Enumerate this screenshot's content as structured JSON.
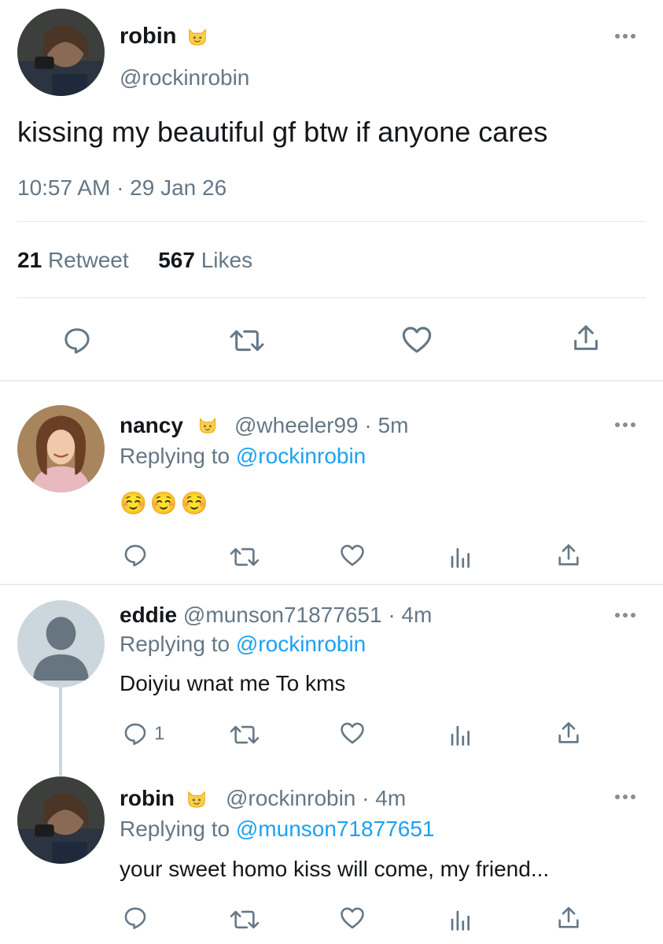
{
  "main_tweet": {
    "name": "robin",
    "handle": "@rockinrobin",
    "text": "kissing my beautiful gf btw if anyone cares",
    "meta": "10:57 AM · 29 Jan 26",
    "retweet_count": "21",
    "retweet_label": "Retweet",
    "like_count": "567",
    "like_label": "Likes"
  },
  "replies": [
    {
      "name": "nancy",
      "handle": "@wheeler99",
      "time": "· 5m",
      "replying_prefix": "Replying to",
      "replying_to": "@rockinrobin",
      "text": "☺️☺️☺️"
    },
    {
      "name": "eddie",
      "handle": "@munson71877651",
      "time": "· 4m",
      "replying_prefix": "Replying to",
      "replying_to": "@rockinrobin",
      "text": "Doiyiu wnat me To kms",
      "reply_count": "1"
    },
    {
      "name": "robin",
      "handle": "@rockinrobin",
      "time": "· 4m",
      "replying_prefix": "Replying to",
      "replying_to": "@munson71877651",
      "text": "your sweet homo kiss will come, my friend..."
    }
  ],
  "icons": {
    "reply": "speech-bubble-icon",
    "retweet": "retweet-arrows-icon",
    "like": "heart-icon",
    "stats": "bar-chart-icon",
    "share": "share-upload-icon",
    "badge": "cat-emoji-icon",
    "more": "ellipsis-icon"
  },
  "colors": {
    "link": "#1da1f2",
    "secondary_text": "#657786",
    "divider": "#e1e8ed"
  }
}
